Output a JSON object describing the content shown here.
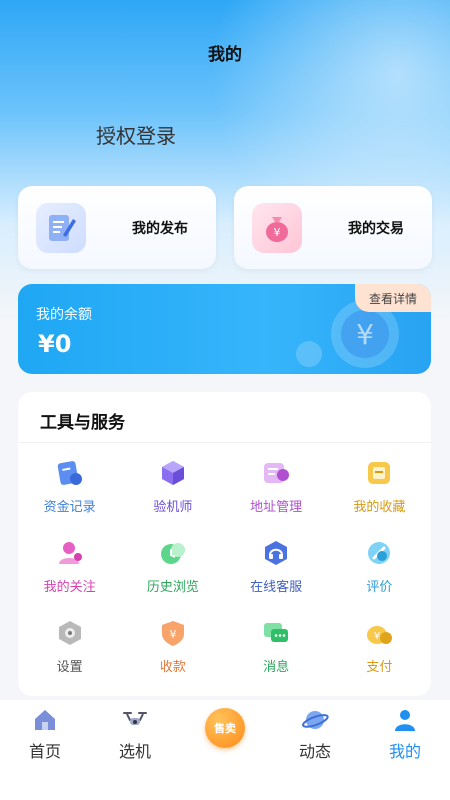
{
  "header": {
    "title": "我的"
  },
  "login": {
    "label": "授权登录"
  },
  "quick_cards": [
    {
      "label": "我的发布",
      "icon": "document-edit-icon"
    },
    {
      "label": "我的交易",
      "icon": "money-bag-icon"
    }
  ],
  "balance": {
    "label": "我的余额",
    "value": "¥0",
    "detail_label": "查看详情"
  },
  "tools": {
    "title": "工具与服务",
    "items": [
      {
        "label": "资金记录",
        "icon": "fund-record-icon",
        "color": "#3f7fd8"
      },
      {
        "label": "验机师",
        "icon": "cube-icon",
        "color": "#6a4dd8"
      },
      {
        "label": "地址管理",
        "icon": "address-icon",
        "color": "#b04fd1"
      },
      {
        "label": "我的收藏",
        "icon": "favorite-icon",
        "color": "#d89a12"
      },
      {
        "label": "我的关注",
        "icon": "follow-icon",
        "color": "#d83fb1"
      },
      {
        "label": "历史浏览",
        "icon": "history-icon",
        "color": "#2aa85a"
      },
      {
        "label": "在线客服",
        "icon": "headset-icon",
        "color": "#3f5fc8"
      },
      {
        "label": "评价",
        "icon": "rating-icon",
        "color": "#2a9fd8"
      },
      {
        "label": "设置",
        "icon": "settings-icon",
        "color": "#555555"
      },
      {
        "label": "收款",
        "icon": "receive-payment-icon",
        "color": "#e07a3a"
      },
      {
        "label": "消息",
        "icon": "message-icon",
        "color": "#2aa85a"
      },
      {
        "label": "支付",
        "icon": "payment-icon",
        "color": "#d89a12"
      }
    ]
  },
  "tabbar": {
    "items": [
      {
        "label": "首页",
        "icon": "home-icon"
      },
      {
        "label": "选机",
        "icon": "drone-icon"
      },
      {
        "label": "动态",
        "icon": "planet-icon"
      },
      {
        "label": "我的",
        "icon": "profile-icon"
      }
    ],
    "center": {
      "label": "售卖",
      "icon": "sell-icon"
    }
  }
}
